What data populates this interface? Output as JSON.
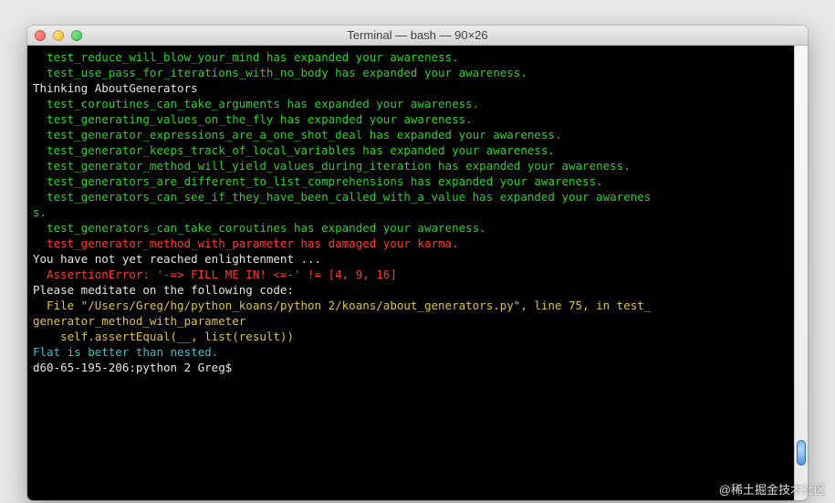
{
  "window": {
    "title": "Terminal — bash — 90×26"
  },
  "lines": [
    {
      "cls": "g",
      "indent": 2,
      "text": "test_reduce_will_blow_your_mind has expanded your awareness."
    },
    {
      "cls": "g",
      "indent": 2,
      "text": "test_use_pass_for_iterations_with_no_body has expanded your awareness."
    },
    {
      "cls": "w",
      "indent": 0,
      "text": ""
    },
    {
      "cls": "w",
      "indent": 0,
      "text": "Thinking AboutGenerators"
    },
    {
      "cls": "g",
      "indent": 2,
      "text": "test_coroutines_can_take_arguments has expanded your awareness."
    },
    {
      "cls": "g",
      "indent": 2,
      "text": "test_generating_values_on_the_fly has expanded your awareness."
    },
    {
      "cls": "g",
      "indent": 2,
      "text": "test_generator_expressions_are_a_one_shot_deal has expanded your awareness."
    },
    {
      "cls": "g",
      "indent": 2,
      "text": "test_generator_keeps_track_of_local_variables has expanded your awareness."
    },
    {
      "cls": "g",
      "indent": 2,
      "text": "test_generator_method_will_yield_values_during_iteration has expanded your awareness."
    },
    {
      "cls": "g",
      "indent": 2,
      "text": "test_generators_are_different_to_list_comprehensions has expanded your awareness."
    },
    {
      "cls": "g",
      "indent": 2,
      "text": "test_generators_can_see_if_they_have_been_called_with_a_value has expanded your awarenes"
    },
    {
      "cls": "g",
      "indent": 0,
      "text": "s."
    },
    {
      "cls": "g",
      "indent": 2,
      "text": "test_generators_can_take_coroutines has expanded your awareness."
    },
    {
      "cls": "r",
      "indent": 2,
      "text": "test_generator_method_with_parameter has damaged your karma."
    },
    {
      "cls": "w",
      "indent": 0,
      "text": ""
    },
    {
      "cls": "w",
      "indent": 0,
      "text": "You have not yet reached enlightenment ..."
    },
    {
      "cls": "r",
      "indent": 2,
      "text": "AssertionError: '-=> FILL ME IN! <=-' != [4, 9, 16]"
    },
    {
      "cls": "w",
      "indent": 0,
      "text": ""
    },
    {
      "cls": "w",
      "indent": 0,
      "text": "Please meditate on the following code:"
    },
    {
      "cls": "y",
      "indent": 2,
      "text": "File \"/Users/Greg/hg/python_koans/python 2/koans/about_generators.py\", line 75, in test_"
    },
    {
      "cls": "y",
      "indent": 0,
      "text": "generator_method_with_parameter"
    },
    {
      "cls": "y",
      "indent": 4,
      "text": "self.assertEqual(__, list(result))"
    },
    {
      "cls": "w",
      "indent": 0,
      "text": ""
    },
    {
      "cls": "w",
      "indent": 0,
      "text": ""
    },
    {
      "cls": "c",
      "indent": 0,
      "text": "Flat is better than nested."
    },
    {
      "cls": "w",
      "indent": 0,
      "text": "d60-65-195-206:python 2 Greg$ "
    }
  ],
  "watermark": "@稀土掘金技术社区"
}
